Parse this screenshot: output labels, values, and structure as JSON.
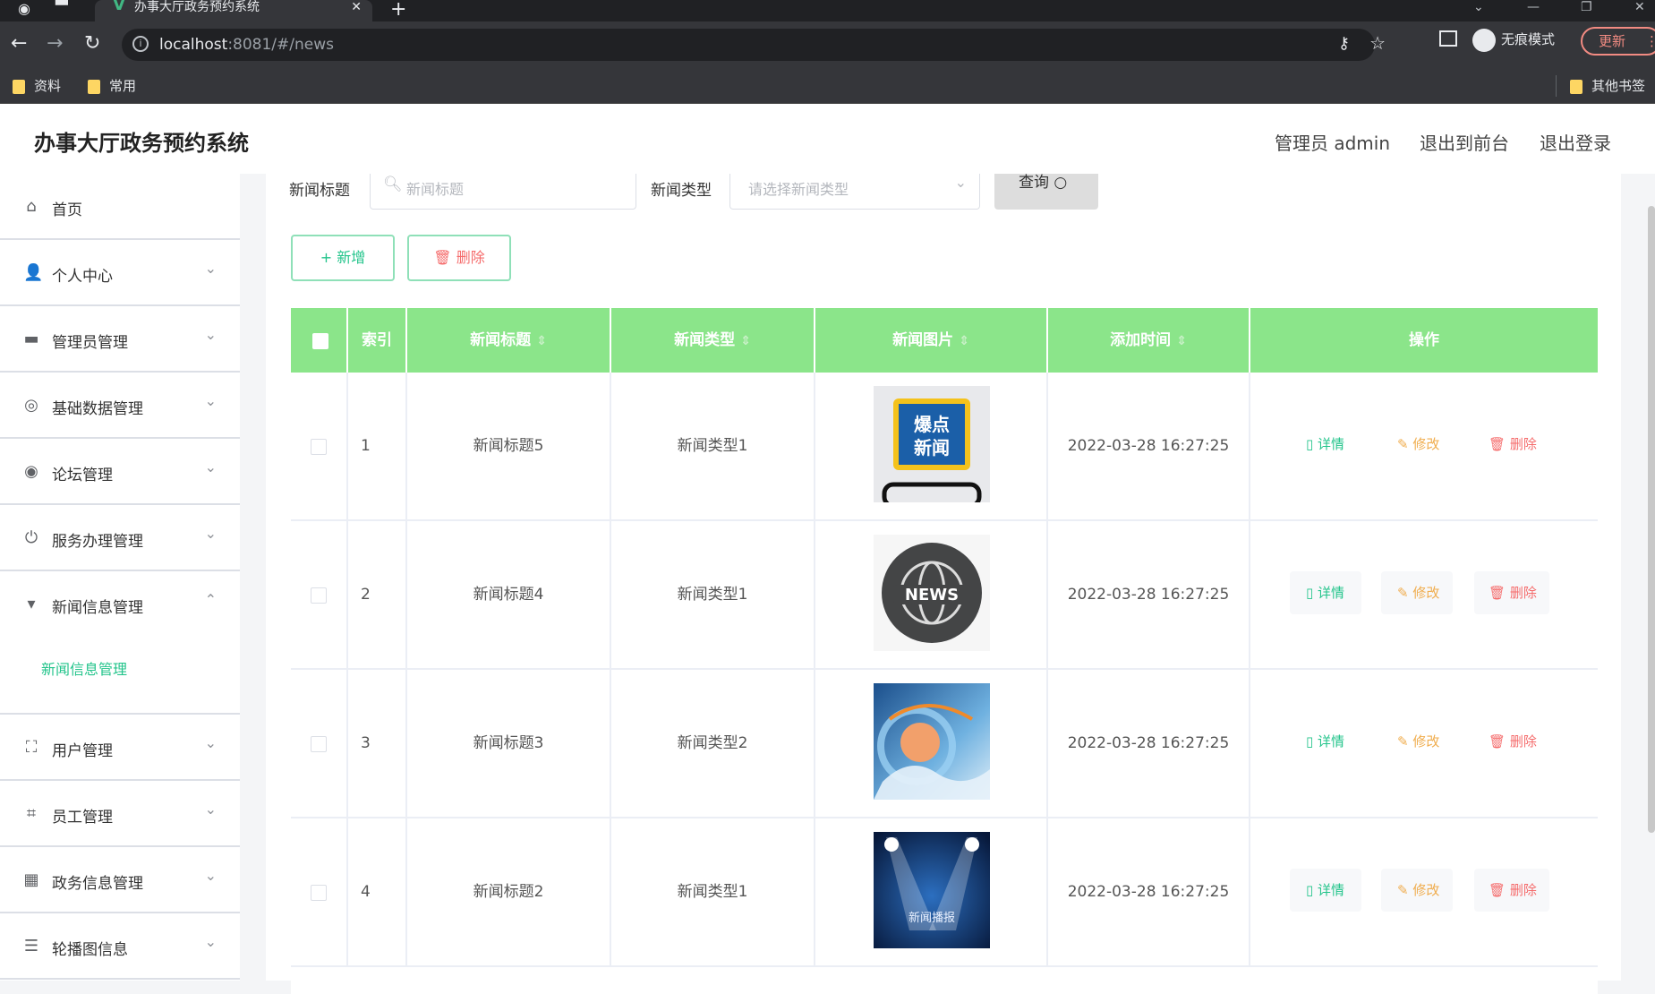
{
  "browser": {
    "tab_title": "办事大厅政务预约系统",
    "url_host": "localhost",
    "url_rest": ":8081/#/news",
    "incognito_label": "无痕模式",
    "update_label": "更新",
    "bookmarks": [
      "资料",
      "常用"
    ],
    "other_bookmarks": "其他书签"
  },
  "header": {
    "title": "办事大厅政务预约系统",
    "user_label": "管理员 admin",
    "back_to_front": "退出到前台",
    "logout": "退出登录"
  },
  "sidebar": {
    "items": [
      {
        "label": "首页",
        "icon": "home-icon"
      },
      {
        "label": "个人中心",
        "icon": "user-icon"
      },
      {
        "label": "管理员管理",
        "icon": "admin-icon"
      },
      {
        "label": "基础数据管理",
        "icon": "data-icon"
      },
      {
        "label": "论坛管理",
        "icon": "forum-icon"
      },
      {
        "label": "服务办理管理",
        "icon": "power-icon"
      },
      {
        "label": "新闻信息管理",
        "icon": "news-icon"
      },
      {
        "label": "用户管理",
        "icon": "fullscreen-icon"
      },
      {
        "label": "员工管理",
        "icon": "crop-icon"
      },
      {
        "label": "政务信息管理",
        "icon": "gov-icon"
      },
      {
        "label": "轮播图信息",
        "icon": "list-icon"
      }
    ],
    "active_sub": "新闻信息管理"
  },
  "filters": {
    "title_label": "新闻标题",
    "title_placeholder": "新闻标题",
    "type_label": "新闻类型",
    "type_placeholder": "请选择新闻类型",
    "query_button": "查询"
  },
  "actions": {
    "add": "新增",
    "delete": "删除"
  },
  "table": {
    "columns": [
      "索引",
      "新闻标题",
      "新闻类型",
      "新闻图片",
      "添加时间",
      "操作"
    ],
    "row_actions": {
      "detail": "详情",
      "edit": "修改",
      "delete": "删除"
    },
    "rows": [
      {
        "index": "1",
        "title": "新闻标题5",
        "type": "新闻类型1",
        "image": "baodian-news-image",
        "time": "2022-03-28 16:27:25"
      },
      {
        "index": "2",
        "title": "新闻标题4",
        "type": "新闻类型1",
        "image": "globe-news-image",
        "time": "2022-03-28 16:27:25"
      },
      {
        "index": "3",
        "title": "新闻标题3",
        "type": "新闻类型2",
        "image": "blue-news-image",
        "time": "2022-03-28 16:27:25"
      },
      {
        "index": "4",
        "title": "新闻标题2",
        "type": "新闻类型1",
        "image": "stage-news-image",
        "time": "2022-03-28 16:27:25"
      }
    ],
    "image_texts": {
      "baodian": "爆点 新闻",
      "globe": "NEWS",
      "stage": "新闻播报"
    }
  },
  "colors": {
    "header_green": "#8be58a",
    "accent_green": "#23c48b",
    "danger_red": "#f56c6c",
    "edit_orange": "#f0ad4e"
  }
}
